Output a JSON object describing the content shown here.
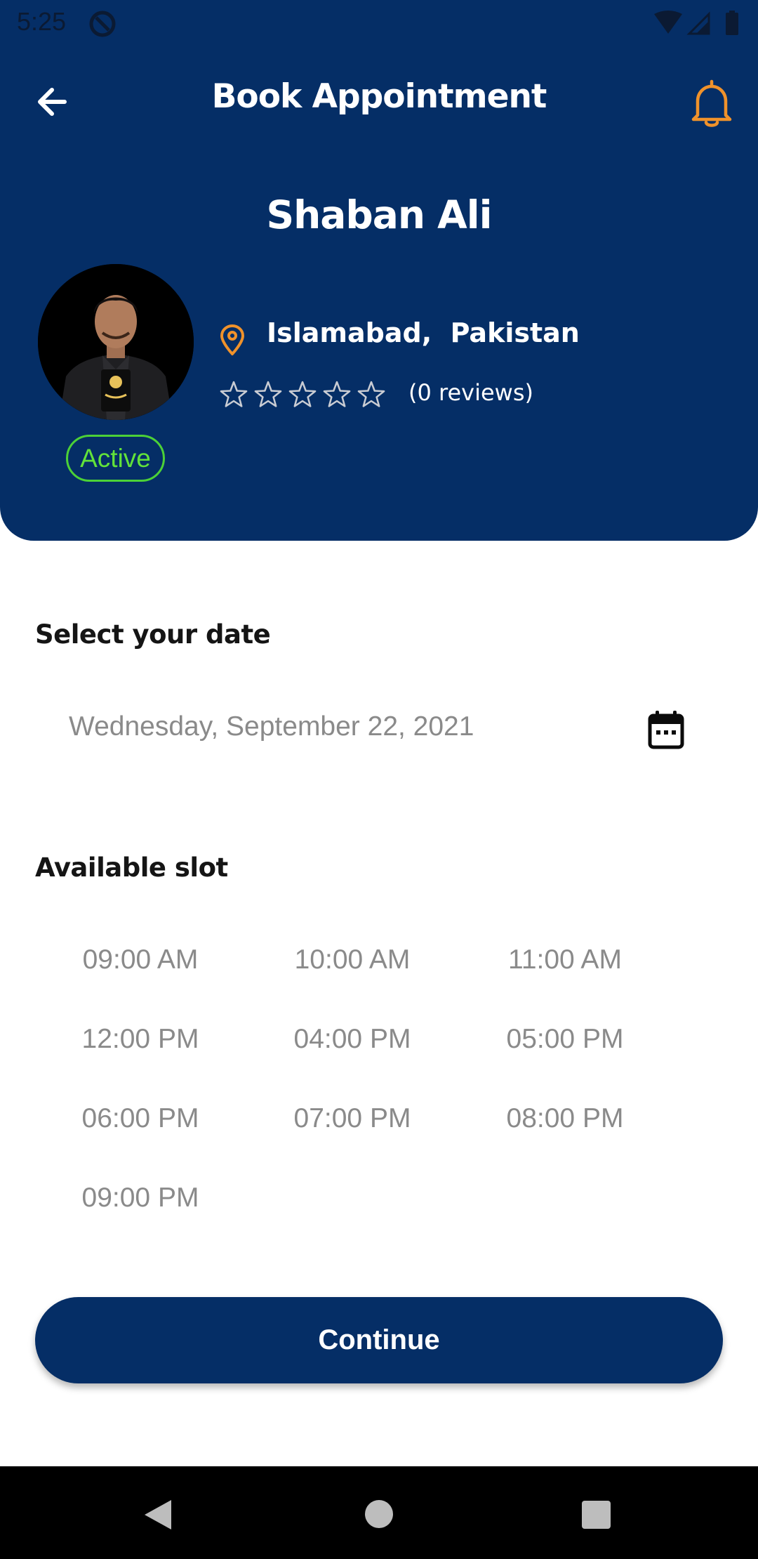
{
  "status_bar": {
    "time": "5:25"
  },
  "header": {
    "title": "Book Appointment",
    "provider_name": "Shaban Ali",
    "status_badge": "Active",
    "location": "Islamabad,  Pakistan",
    "rating": 0,
    "rating_max": 5,
    "reviews": "(0 reviews)"
  },
  "date_section": {
    "label": "Select your date",
    "selected_date": "Wednesday, September 22, 2021"
  },
  "slot_section": {
    "label": "Available slot",
    "slots": [
      "09:00 AM",
      "10:00 AM",
      "11:00 AM",
      "12:00 PM",
      "04:00 PM",
      "05:00 PM",
      "06:00 PM",
      "07:00 PM",
      "08:00 PM",
      "09:00 PM"
    ]
  },
  "continue_label": "Continue",
  "colors": {
    "primary": "#052e66",
    "accent_orange": "#f0922b",
    "active_green": "#4cd137",
    "slot_text": "#8a8a8a"
  },
  "icons": {
    "back": "arrow-left-icon",
    "notifications": "bell-icon",
    "location": "map-pin-icon",
    "calendar": "calendar-icon",
    "rating": "star-outline-icon"
  }
}
